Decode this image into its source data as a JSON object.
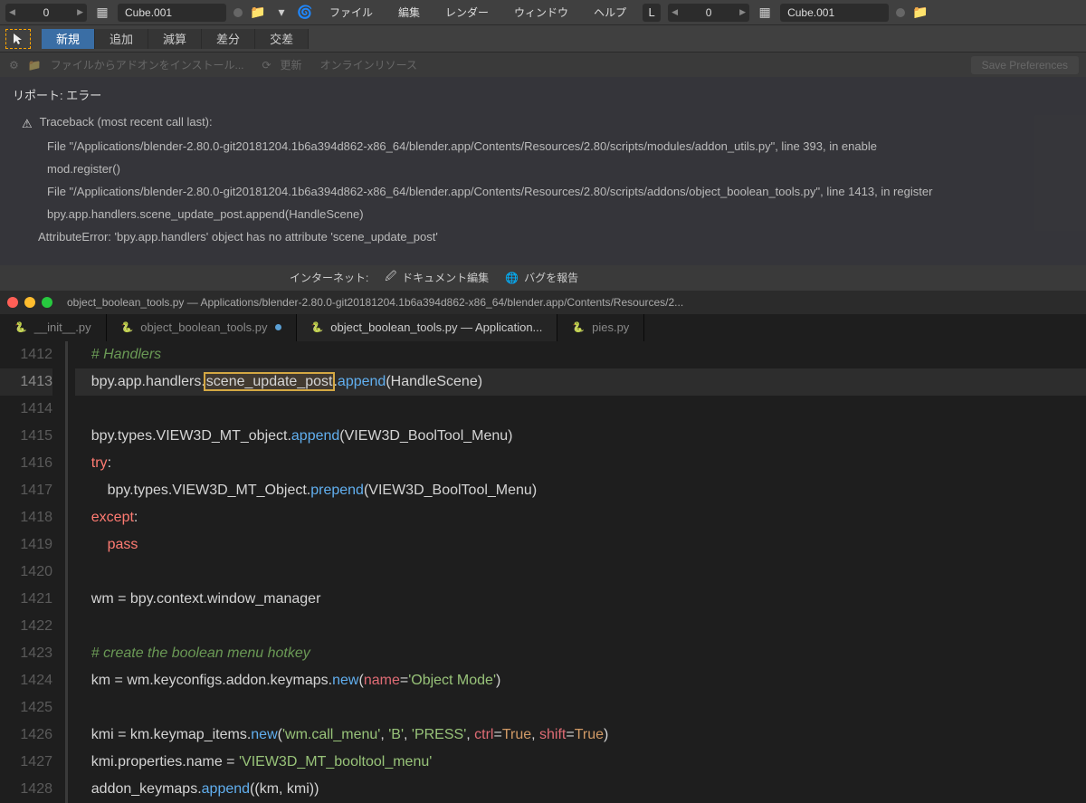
{
  "topbar": {
    "num1": "0",
    "obj1": "Cube.001",
    "menus": [
      "ファイル",
      "編集",
      "レンダー",
      "ウィンドウ",
      "ヘルプ"
    ],
    "tabL": "L",
    "num2": "0",
    "obj2": "Cube.001"
  },
  "toolbar": {
    "items": [
      "新規",
      "追加",
      "減算",
      "差分",
      "交差"
    ]
  },
  "secondary": {
    "install": "ファイルからアドオンをインストール...",
    "refresh": "更新",
    "online": "オンラインリソース",
    "save": "Save Preferences"
  },
  "report": {
    "title": "リポート: エラー",
    "l1": "Traceback (most recent call last):",
    "l2": "File \"/Applications/blender-2.80.0-git20181204.1b6a394d862-x86_64/blender.app/Contents/Resources/2.80/scripts/modules/addon_utils.py\", line 393, in enable",
    "l3": "mod.register()",
    "l4": "File \"/Applications/blender-2.80.0-git20181204.1b6a394d862-x86_64/blender.app/Contents/Resources/2.80/scripts/addons/object_boolean_tools.py\", line 1413, in register",
    "l5": "bpy.app.handlers.scene_update_post.append(HandleScene)",
    "l6": "AttributeError: 'bpy.app.handlers' object has no attribute 'scene_update_post'"
  },
  "links": {
    "internet": "インターネット:",
    "docs": "ドキュメント編集",
    "bug": "バグを報告"
  },
  "editor": {
    "title": "object_boolean_tools.py — Applications/blender-2.80.0-git20181204.1b6a394d862-x86_64/blender.app/Contents/Resources/2...",
    "tabs": [
      {
        "label": "__init__.py",
        "active": false
      },
      {
        "label": "object_boolean_tools.py",
        "active": false,
        "mod": true
      },
      {
        "label": "object_boolean_tools.py — Application...",
        "active": true
      },
      {
        "label": "pies.py",
        "active": false
      }
    ],
    "lines": [
      1412,
      1413,
      1414,
      1415,
      1416,
      1417,
      1418,
      1419,
      1420,
      1421,
      1422,
      1423,
      1424,
      1425,
      1426,
      1427,
      1428
    ],
    "active_line": 1413
  }
}
